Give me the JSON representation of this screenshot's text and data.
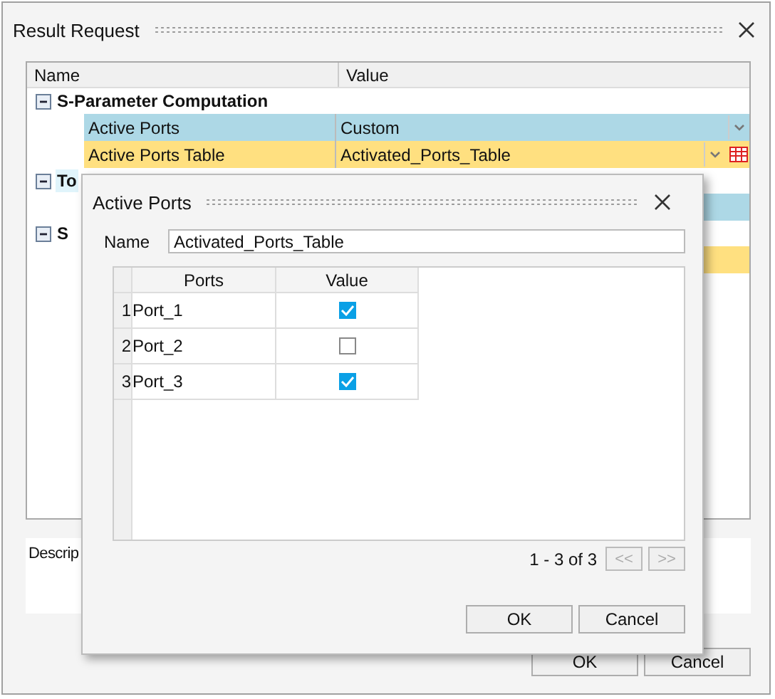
{
  "window": {
    "title": "Result Request"
  },
  "tree": {
    "columns": [
      "Name",
      "Value"
    ],
    "groups": [
      {
        "label": "S-Parameter Computation",
        "expanded": true,
        "selected": false,
        "children": [
          {
            "label": "Active Ports",
            "value": "Custom",
            "color": "#add8e6",
            "table_button": false
          },
          {
            "label": "Active Ports Table",
            "value": "Activated_Ports_Table",
            "color": "#ffe080",
            "table_button": true
          }
        ]
      },
      {
        "label": "To",
        "expanded": true,
        "selected": true,
        "children": [
          {
            "color": "#add8e6"
          }
        ]
      },
      {
        "label": "S",
        "expanded": true,
        "selected": false,
        "children": [
          {
            "color": "#ffe080"
          }
        ]
      }
    ]
  },
  "description": {
    "label": "Descrip"
  },
  "buttons": [
    "OK",
    "Cancel"
  ],
  "dialog": {
    "title": "Active Ports",
    "name_label": "Name",
    "name_value": "Activated_Ports_Table",
    "columns": [
      "Ports",
      "Value"
    ],
    "rows": [
      {
        "number": "1",
        "port": "Port_1",
        "checked": true
      },
      {
        "number": "2",
        "port": "Port_2",
        "checked": false
      },
      {
        "number": "3",
        "port": "Port_3",
        "checked": true
      }
    ],
    "pagination": "1 - 3 of 3",
    "prev": "<<",
    "next": ">>",
    "prev_disabled": true,
    "next_disabled": true,
    "buttons": [
      "OK",
      "Cancel"
    ]
  }
}
